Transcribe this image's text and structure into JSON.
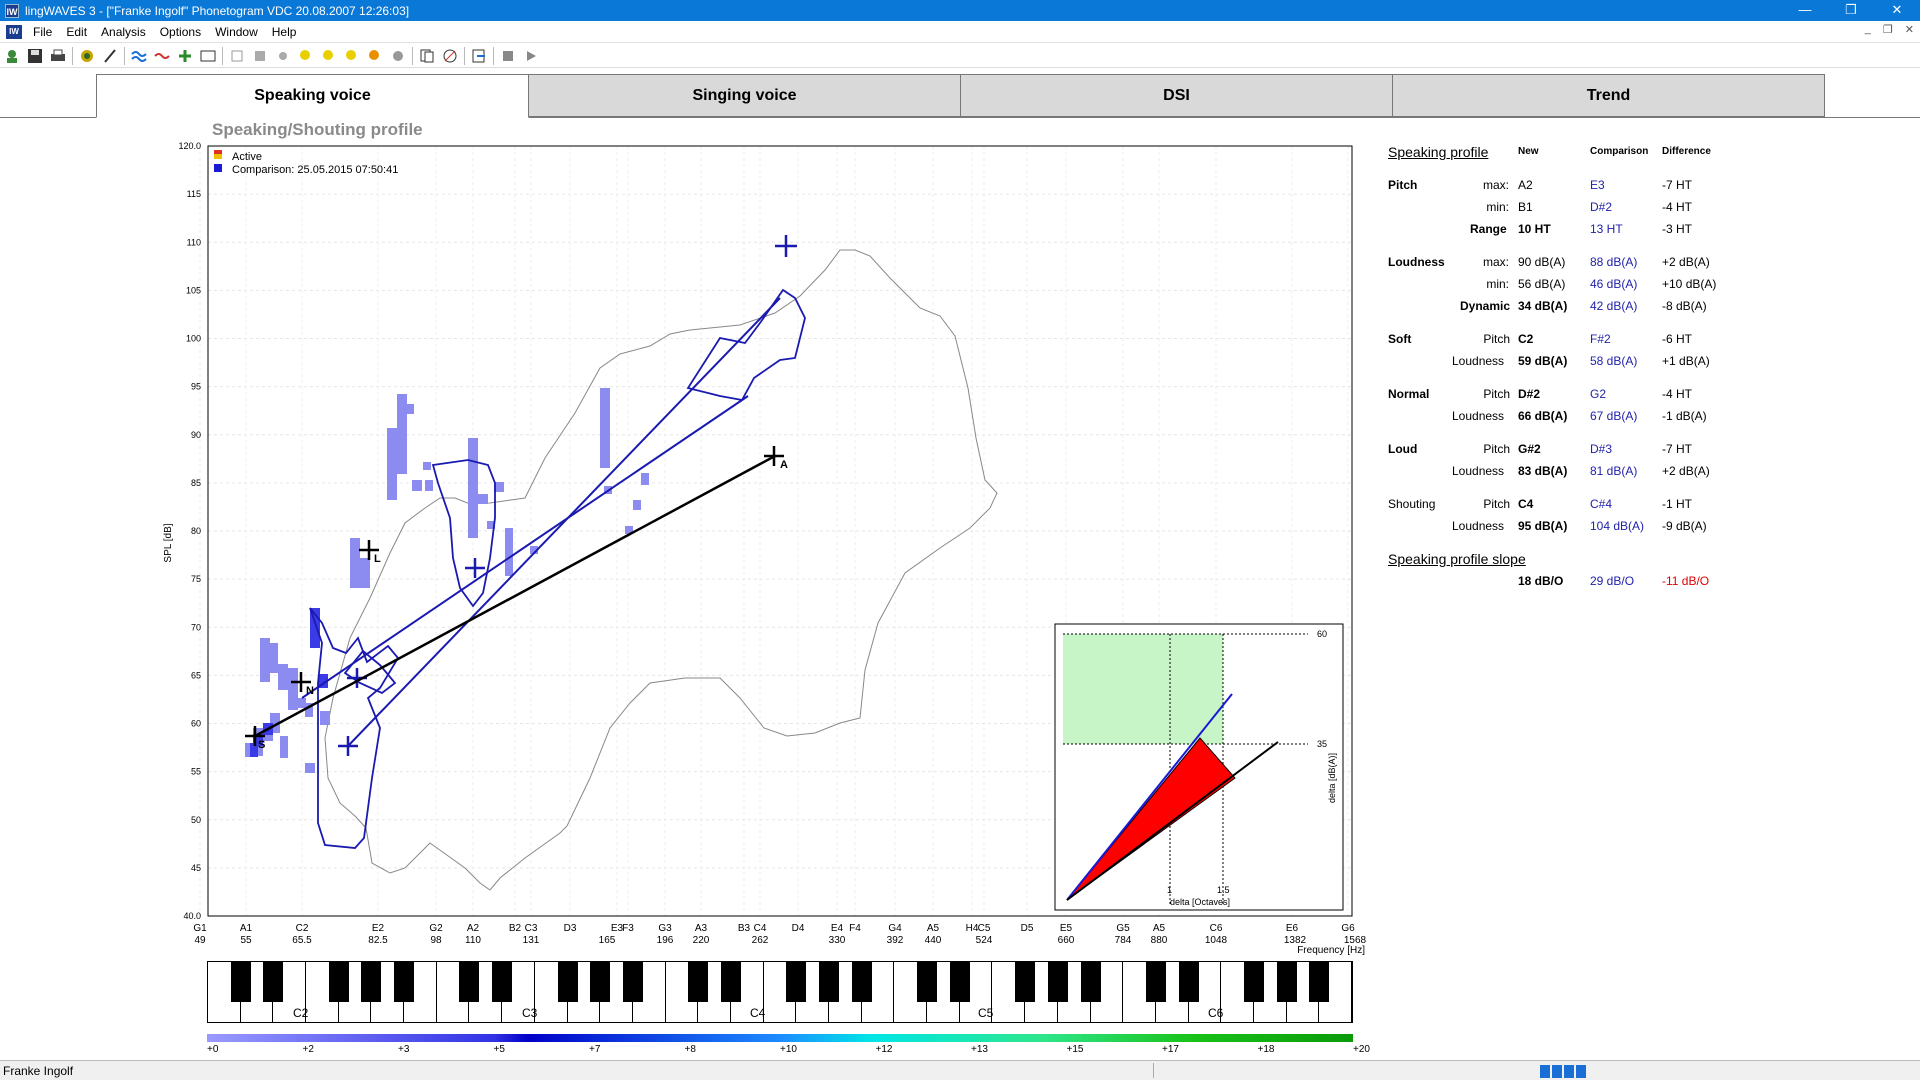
{
  "window": {
    "title": "lingWAVES 3 - [\"Franke Ingolf\" Phonetogram VDC  20.08.2007 12:26:03]",
    "app_icon": "IW",
    "minimize": "—",
    "maximize": "❐",
    "close": "✕"
  },
  "menu": [
    "File",
    "Edit",
    "Analysis",
    "Options",
    "Window",
    "Help"
  ],
  "mdi_icon": "IW",
  "tabs": [
    "Speaking voice",
    "Singing voice",
    "DSI",
    "Trend"
  ],
  "chart_title": "Speaking/Shouting profile",
  "legend": {
    "active": "Active",
    "comparison": "Comparison: 25.05.2015 07:50:41"
  },
  "axes": {
    "ylabel": "SPL [dB]",
    "xlabel": "Frequency [Hz]",
    "ylim": [
      40,
      120
    ],
    "y_ticks": [
      "120.0",
      "115",
      "110",
      "105",
      "100",
      "95",
      "90",
      "85",
      "80",
      "75",
      "70",
      "65",
      "60",
      "55",
      "50",
      "45",
      "40.0"
    ],
    "x_notes": [
      "G1",
      "A1",
      "C2",
      "E2",
      "G2",
      "A2",
      "B2",
      "C3",
      "D3",
      "E3",
      "F3",
      "G3",
      "A3",
      "B3",
      "C4",
      "D4",
      "E4",
      "F4",
      "G4",
      "A5",
      "H4",
      "C5",
      "D5",
      "E5",
      "G5",
      "A5",
      "C6",
      "E6",
      "G6"
    ],
    "x_freqs": [
      "49",
      "55",
      "65.5",
      "82.5",
      "98",
      "110",
      "131",
      "165",
      "196",
      "220",
      "262",
      "330",
      "392",
      "440",
      "524",
      "660",
      "784",
      "880",
      "1048",
      "1382",
      "1568"
    ]
  },
  "markers": {
    "s": "S",
    "n": "N",
    "l": "L",
    "a": "A"
  },
  "chart_data": {
    "type": "scatter",
    "title": "Speaking/Shouting profile",
    "xlabel": "Frequency [Hz]",
    "ylabel": "SPL [dB]",
    "ylim": [
      40,
      120
    ],
    "series": [
      {
        "name": "Active",
        "points": [
          {
            "x": "C2",
            "y": 59
          },
          {
            "x": "D#2",
            "y": 66
          },
          {
            "x": "G#2",
            "y": 83
          },
          {
            "x": "C4",
            "y": 95
          }
        ]
      },
      {
        "name": "Comparison: 25.05.2015 07:50:41",
        "points": [
          {
            "x": "F#2",
            "y": 58
          },
          {
            "x": "G2",
            "y": 67
          },
          {
            "x": "D#3",
            "y": 81
          },
          {
            "x": "C#4",
            "y": 104
          }
        ]
      }
    ]
  },
  "inset": {
    "y_label": "delta [dB(A)]",
    "x_label": "delta [Octaves]",
    "y_ticks": [
      "60",
      "35"
    ],
    "x_ticks": [
      "1",
      "1.5"
    ]
  },
  "keyboard_labels": [
    "C2",
    "C3",
    "C4",
    "C5",
    "C6"
  ],
  "scale_labels": [
    "+0",
    "+2",
    "+3",
    "+5",
    "+7",
    "+8",
    "+10",
    "+12",
    "+13",
    "+15",
    "+17",
    "+18",
    "+20"
  ],
  "profile": {
    "title": "Speaking profile",
    "col_new": "New",
    "col_comparison": "Comparison",
    "col_difference": "Difference",
    "rows": [
      {
        "group": "Pitch",
        "label": "max:",
        "new": "A2",
        "cmp": "E3",
        "diff": "-7 HT"
      },
      {
        "group": "",
        "label": "min:",
        "new": "B1",
        "cmp": "D#2",
        "diff": "-4 HT"
      },
      {
        "group": "",
        "label": "Range",
        "new": "10 HT",
        "cmp": "13 HT",
        "diff": "-3 HT"
      },
      {
        "group": "Loudness",
        "label": "max:",
        "new": "90 dB(A)",
        "cmp": "88 dB(A)",
        "diff": "+2 dB(A)"
      },
      {
        "group": "",
        "label": "min:",
        "new": "56 dB(A)",
        "cmp": "46 dB(A)",
        "diff": "+10 dB(A)"
      },
      {
        "group": "",
        "label": "Dynamic",
        "new": "34 dB(A)",
        "cmp": "42 dB(A)",
        "diff": "-8 dB(A)"
      },
      {
        "group": "Soft",
        "label": "Pitch",
        "new": "C2",
        "cmp": "F#2",
        "diff": "-6 HT"
      },
      {
        "group": "",
        "label": "Loudness",
        "new": "59 dB(A)",
        "cmp": "58 dB(A)",
        "diff": "+1 dB(A)"
      },
      {
        "group": "Normal",
        "label": "Pitch",
        "new": "D#2",
        "cmp": "G2",
        "diff": "-4 HT"
      },
      {
        "group": "",
        "label": "Loudness",
        "new": "66 dB(A)",
        "cmp": "67 dB(A)",
        "diff": "-1 dB(A)"
      },
      {
        "group": "Loud",
        "label": "Pitch",
        "new": "G#2",
        "cmp": "D#3",
        "diff": "-7 HT"
      },
      {
        "group": "",
        "label": "Loudness",
        "new": "83 dB(A)",
        "cmp": "81 dB(A)",
        "diff": "+2 dB(A)"
      },
      {
        "group": "Shouting",
        "label": "Pitch",
        "new": "C4",
        "cmp": "C#4",
        "diff": "-1 HT"
      },
      {
        "group": "",
        "label": "Loudness",
        "new": "95 dB(A)",
        "cmp": "104 dB(A)",
        "diff": "-9 dB(A)"
      }
    ],
    "slope_title": "Speaking profile slope",
    "slope": {
      "new": "18 dB/O",
      "cmp": "29 dB/O",
      "diff": "-11 dB/O"
    }
  },
  "status": {
    "user": "Franke Ingolf"
  },
  "toolbar_icons": [
    "patient-icon",
    "save-icon",
    "print-icon",
    "analysis-icon",
    "pen-icon",
    "waves-icon",
    "eraser-icon",
    "norm-icon",
    "norm-text-icon",
    "select-rect-icon",
    "select-fill-icon",
    "circle-icon",
    "soft-marker-icon",
    "normal-marker-icon",
    "loud-marker-icon",
    "shout-marker-icon",
    "gear-marker-icon",
    "copy-icon",
    "compare-icon",
    "export-icon",
    "stop-icon",
    "play-icon"
  ]
}
